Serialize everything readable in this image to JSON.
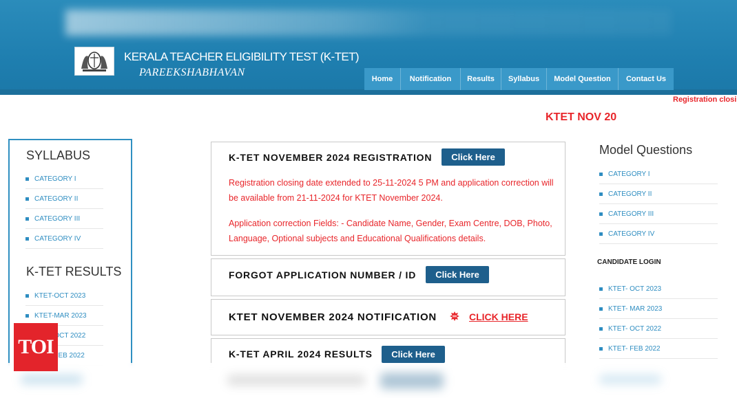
{
  "header": {
    "site_title": "KERALA TEACHER ELIGIBILITY TEST (K-TET)",
    "site_subtitle": "PAREEKSHABHAVAN",
    "logo_icon": "kerala-emblem-icon"
  },
  "nav": {
    "items": [
      "Home",
      "Notification",
      "Results",
      "Syllabus",
      "Model Question",
      "Contact Us"
    ]
  },
  "marquee_text": "Registration closin",
  "banner_text": "KTET NOV 20",
  "left_sidebar": {
    "syllabus_heading": "SYLLABUS",
    "syllabus_items": [
      "CATEGORY I",
      "CATEGORY II",
      "CATEGORY III",
      "CATEGORY IV"
    ],
    "results_heading": "K-TET RESULTS",
    "results_items": [
      "KTET-OCT 2023",
      "KTET-MAR 2023",
      "KTET-OCT 2022",
      "KTET-FEB 2022"
    ]
  },
  "right_sidebar": {
    "model_heading": "Model Questions",
    "model_items": [
      "CATEGORY I",
      "CATEGORY II",
      "CATEGORY III",
      "CATEGORY IV"
    ],
    "login_heading": "CANDIDATE LOGIN",
    "login_items": [
      "KTET- OCT 2023",
      "KTET- MAR 2023",
      "KTET- OCT 2022",
      "KTET- FEB 2022"
    ]
  },
  "main": {
    "registration": {
      "title": "K-TET NOVEMBER 2024 REGISTRATION",
      "button": "Click Here",
      "para1": "Registration closing date extended to 25-11-2024 5 PM and application correction will be available from 21-11-2024 for KTET November 2024.",
      "para2": "Application correction Fields: - Candidate Name, Gender, Exam Centre, DOB, Photo, Language, Optional subjects and Educational Qualifications details."
    },
    "forgot": {
      "title": "FORGOT APPLICATION NUMBER / ID",
      "button": "Click Here"
    },
    "notification": {
      "title": "KTET NOVEMBER 2024 NOTIFICATION",
      "new_icon": "new-badge-icon",
      "link": "CLICK HERE"
    },
    "results": {
      "title": "K-TET APRIL 2024 RESULTS",
      "button": "Click Here"
    }
  },
  "watermark": "TOI",
  "colors": {
    "header_blue": "#1f7fb0",
    "nav_blue": "#3a99c9",
    "button_navy": "#1e5f8c",
    "alert_red": "#e8252a",
    "link_blue": "#2e8dc1"
  }
}
